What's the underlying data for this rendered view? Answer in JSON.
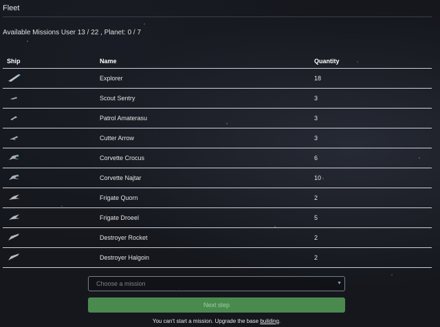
{
  "header": {
    "title": "Fleet",
    "missions_text": "Available Missions User 13 / 22 , Planet: 0 / 7"
  },
  "table": {
    "columns": [
      "Ship",
      "Name",
      "Quantity"
    ],
    "rows": [
      {
        "icon": "explorer-ship-icon",
        "name": "Explorer",
        "quantity": "18"
      },
      {
        "icon": "scout-ship-icon",
        "name": "Scout Sentry",
        "quantity": "3"
      },
      {
        "icon": "patrol-ship-icon",
        "name": "Patrol Amaterasu",
        "quantity": "3"
      },
      {
        "icon": "cutter-ship-icon",
        "name": "Cutter Arrow",
        "quantity": "3"
      },
      {
        "icon": "corvette-ship-icon",
        "name": "Corvette Crocus",
        "quantity": "6"
      },
      {
        "icon": "corvette-ship-icon",
        "name": "Corvette Najtar",
        "quantity": "10"
      },
      {
        "icon": "frigate-ship-icon",
        "name": "Frigate Quorn",
        "quantity": "2"
      },
      {
        "icon": "frigate-ship-icon",
        "name": "Frigate Droeel",
        "quantity": "5"
      },
      {
        "icon": "destroyer-ship-icon",
        "name": "Destroyer Rocket",
        "quantity": "2"
      },
      {
        "icon": "destroyer-ship-icon",
        "name": "Destroyer Halgoin",
        "quantity": "2"
      }
    ]
  },
  "mission_select": {
    "placeholder": "Choose a mission"
  },
  "next_button": {
    "label": "Next step"
  },
  "footer": {
    "note_prefix": "You can't start a mission. Upgrade the base ",
    "note_link": "building",
    "note_suffix": "."
  },
  "colors": {
    "button_bg": "#4a8a4f",
    "rule": "#cfd2d8",
    "background": "#15171d"
  }
}
